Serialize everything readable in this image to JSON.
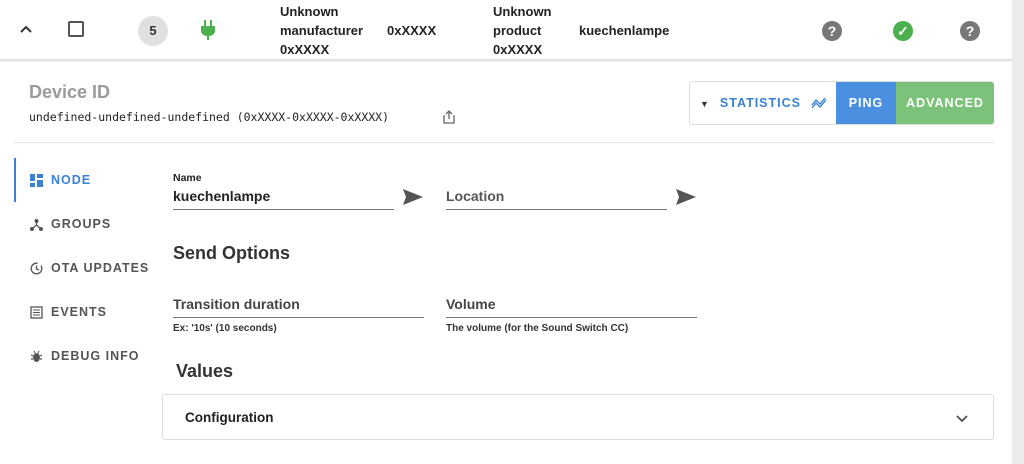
{
  "node_row": {
    "node_id": "5",
    "manufacturer_line1": "Unknown",
    "manufacturer_line2": "manufacturer",
    "manufacturer_id": "0xXXXX",
    "product_type": "0xXXXX",
    "product_line1": "Unknown",
    "product_line2": "product",
    "product_id": "0xXXXX",
    "name": "kuechenlampe",
    "status_icons": [
      "help-circle-icon",
      "check-circle-icon",
      "help-circle-icon"
    ]
  },
  "device": {
    "title": "Device ID",
    "id": "undefined-undefined-undefined (0xXXXX-0xXXXX-0xXXXX)"
  },
  "toolbar": {
    "statistics_label": "STATISTICS",
    "ping_label": "PING",
    "advanced_label": "ADVANCED"
  },
  "nav": {
    "items": [
      {
        "label": "NODE",
        "icon": "dashboard-icon",
        "active": true
      },
      {
        "label": "GROUPS",
        "icon": "groups-icon",
        "active": false
      },
      {
        "label": "OTA UPDATES",
        "icon": "ota-update-icon",
        "active": false
      },
      {
        "label": "EVENTS",
        "icon": "events-list-icon",
        "active": false
      },
      {
        "label": "DEBUG INFO",
        "icon": "bug-icon",
        "active": false
      }
    ]
  },
  "form": {
    "name_label": "Name",
    "name_value": "kuechenlampe",
    "location_placeholder": "Location",
    "send_options_title": "Send Options",
    "transition_label": "Transition duration",
    "transition_help": "Ex: '10s' (10 seconds)",
    "volume_label": "Volume",
    "volume_help": "The volume (for the Sound Switch CC)"
  },
  "values": {
    "title": "Values",
    "config_label": "Configuration"
  },
  "colors": {
    "accent": "#3b82d6",
    "ping": "#4a8fe0",
    "advanced": "#7cc27a",
    "ok": "#4caf50",
    "plug": "#4caf50"
  }
}
